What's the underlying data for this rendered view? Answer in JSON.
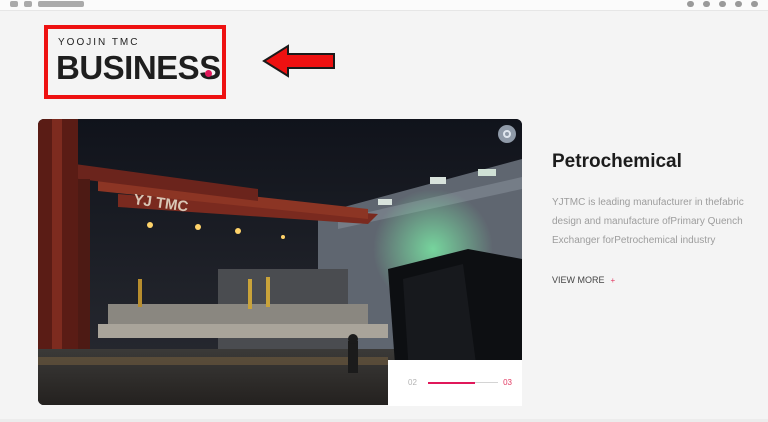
{
  "header": {
    "subtitle": "YOOJIN TMC",
    "title": "BUSINESS"
  },
  "colors": {
    "accent": "#e0185a",
    "annotation": "#ee1111"
  },
  "icons": {
    "annotation_arrow": "left-arrow-icon",
    "photo_button": "circle-icon"
  },
  "photo": {
    "banner_text": "YJ TMC"
  },
  "content": {
    "title": "Petrochemical",
    "description": "YJTMC is leading manufacturer in thefabric\ndesign and manufacture ofPrimary Quench\nExchanger forPetrochemical industry",
    "view_more": "VIEW MORE",
    "view_more_icon": "+"
  },
  "slider": {
    "current": "02",
    "total": "03",
    "progress": 0.67
  }
}
